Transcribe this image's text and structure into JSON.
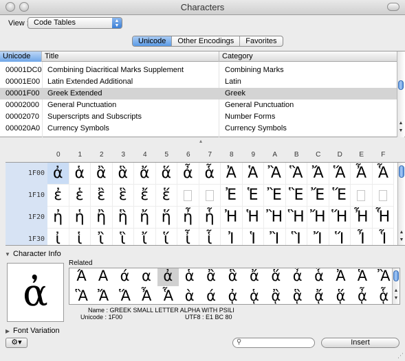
{
  "window": {
    "title": "Characters"
  },
  "toolbar": {
    "view_label": "View :",
    "view_value": "Code Tables"
  },
  "tabs": [
    {
      "label": "Unicode",
      "selected": true
    },
    {
      "label": "Other Encodings",
      "selected": false
    },
    {
      "label": "Favorites",
      "selected": false
    }
  ],
  "table": {
    "columns": [
      "Unicode",
      "Title",
      "Category"
    ],
    "rows": [
      {
        "code": "00001DC0",
        "title": "Combining Diacritical Marks Supplement",
        "category": "Combining Marks"
      },
      {
        "code": "00001E00",
        "title": "Latin Extended Additional",
        "category": "Latin"
      },
      {
        "code": "00001F00",
        "title": "Greek Extended",
        "category": "Greek"
      },
      {
        "code": "00002000",
        "title": "General Punctuation",
        "category": "General Punctuation"
      },
      {
        "code": "00002070",
        "title": "Superscripts and Subscripts",
        "category": "Number Forms"
      },
      {
        "code": "000020A0",
        "title": "Currency Symbols",
        "category": "Currency Symbols"
      }
    ],
    "selected_index": 2
  },
  "grid": {
    "col_headers": [
      "0",
      "1",
      "2",
      "3",
      "4",
      "5",
      "6",
      "7",
      "8",
      "9",
      "A",
      "B",
      "C",
      "D",
      "E",
      "F"
    ],
    "rows": [
      {
        "label": "1F00",
        "chars": [
          "ἀ",
          "ἁ",
          "ἂ",
          "ἃ",
          "ἄ",
          "ἅ",
          "ἆ",
          "ἇ",
          "Ἀ",
          "Ἁ",
          "Ἂ",
          "Ἃ",
          "Ἄ",
          "Ἅ",
          "Ἆ",
          "Ἇ"
        ]
      },
      {
        "label": "1F10",
        "chars": [
          "ἐ",
          "ἑ",
          "ἒ",
          "ἓ",
          "ἔ",
          "ἕ",
          "",
          "",
          "Ἐ",
          "Ἑ",
          "Ἒ",
          "Ἓ",
          "Ἔ",
          "Ἕ",
          "",
          ""
        ]
      },
      {
        "label": "1F20",
        "chars": [
          "ἠ",
          "ἡ",
          "ἢ",
          "ἣ",
          "ἤ",
          "ἥ",
          "ἦ",
          "ἧ",
          "Ἠ",
          "Ἡ",
          "Ἢ",
          "Ἣ",
          "Ἤ",
          "Ἥ",
          "Ἦ",
          "Ἧ"
        ]
      },
      {
        "label": "1F30",
        "chars": [
          "ἰ",
          "ἱ",
          "ἲ",
          "ἳ",
          "ἴ",
          "ἵ",
          "ἶ",
          "ἷ",
          "Ἰ",
          "Ἱ",
          "Ἲ",
          "Ἳ",
          "Ἴ",
          "Ἵ",
          "Ἶ",
          "Ἷ"
        ]
      }
    ],
    "selected": "ἀ"
  },
  "char_info": {
    "section_label": "Character Info",
    "big_char": "ἀ",
    "related_label": "Related",
    "related_rows": [
      [
        "Ά",
        "Α",
        "ά",
        "α",
        "ἀ",
        "ἁ",
        "ἂ",
        "ἃ",
        "ἄ",
        "ἅ",
        "ἆ",
        "ἇ",
        "Ἀ",
        "Ἁ",
        "Ἂ"
      ],
      [
        "Ἃ",
        "Ἄ",
        "Ἅ",
        "Ἆ",
        "Ἇ",
        "ὰ",
        "ά",
        "ᾀ",
        "ᾁ",
        "ᾂ",
        "ᾃ",
        "ᾄ",
        "ᾅ",
        "ᾆ",
        "ᾇ"
      ]
    ],
    "name_line": "Name :  GREEK SMALL LETTER ALPHA WITH PSILI",
    "unicode_line": "Unicode :  1F00",
    "utf8_line": "UTF8 :  E1 BC 80"
  },
  "font_variation": {
    "label": "Font Variation"
  },
  "bottom": {
    "search_placeholder": "",
    "insert_label": "Insert",
    "gear_glyph": "⚙▾"
  }
}
